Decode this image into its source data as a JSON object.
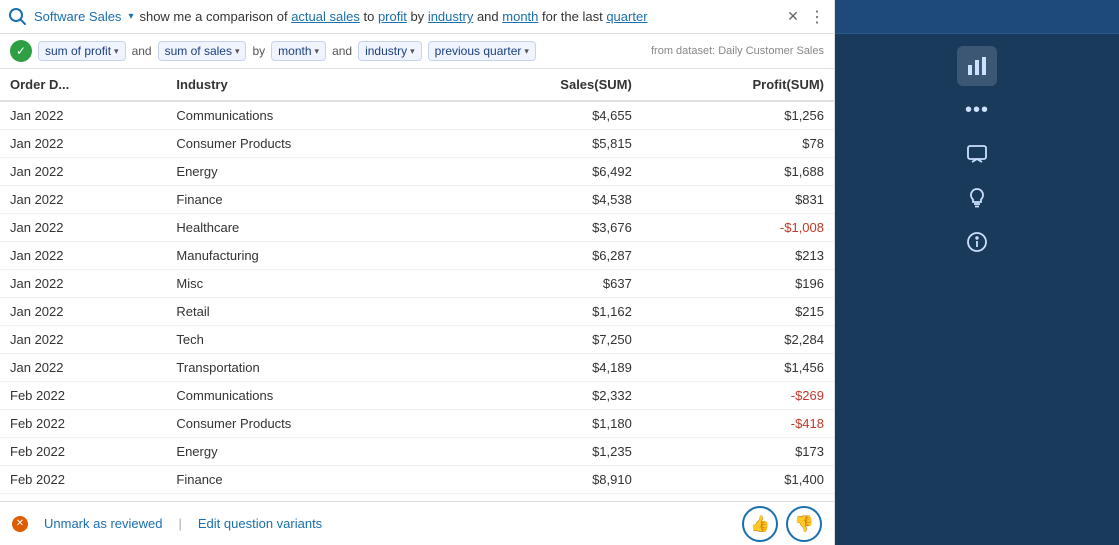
{
  "app": {
    "name": "Software Sales",
    "name_arrow": "▾"
  },
  "search": {
    "query_prefix": "show me a comparison of ",
    "query_part1": "actual sales",
    "query_between1": " to ",
    "query_part2": "profit",
    "query_between2": " by ",
    "query_part3": "industry",
    "query_between3": " and ",
    "query_part4": "month",
    "query_suffix": " for the last ",
    "query_part5": "quarter"
  },
  "filters": {
    "confirm_check": "✓",
    "chip1": "sum of profit",
    "chip1_arrow": "▾",
    "sep1": "and",
    "chip2": "sum of sales",
    "chip2_arrow": "▾",
    "sep2": "by",
    "chip3": "month",
    "chip3_arrow": "▾",
    "sep3": "and",
    "chip4": "industry",
    "chip4_arrow": "▾",
    "chip5": "previous quarter",
    "chip5_arrow": "▾"
  },
  "dataset": {
    "label": "from dataset: Daily Customer Sales"
  },
  "table": {
    "headers": [
      "Order D...",
      "Industry",
      "Sales(SUM)",
      "Profit(SUM)"
    ],
    "rows": [
      [
        "Jan 2022",
        "Communications",
        "$4,655",
        "$1,256"
      ],
      [
        "Jan 2022",
        "Consumer Products",
        "$5,815",
        "$78"
      ],
      [
        "Jan 2022",
        "Energy",
        "$6,492",
        "$1,688"
      ],
      [
        "Jan 2022",
        "Finance",
        "$4,538",
        "$831"
      ],
      [
        "Jan 2022",
        "Healthcare",
        "$3,676",
        "-$1,008"
      ],
      [
        "Jan 2022",
        "Manufacturing",
        "$6,287",
        "$213"
      ],
      [
        "Jan 2022",
        "Misc",
        "$637",
        "$196"
      ],
      [
        "Jan 2022",
        "Retail",
        "$1,162",
        "$215"
      ],
      [
        "Jan 2022",
        "Tech",
        "$7,250",
        "$2,284"
      ],
      [
        "Jan 2022",
        "Transportation",
        "$4,189",
        "$1,456"
      ],
      [
        "Feb 2022",
        "Communications",
        "$2,332",
        "-$269"
      ],
      [
        "Feb 2022",
        "Consumer Products",
        "$1,180",
        "-$418"
      ],
      [
        "Feb 2022",
        "Energy",
        "$1,235",
        "$173"
      ],
      [
        "Feb 2022",
        "Finance",
        "$8,910",
        "$1,400"
      ]
    ]
  },
  "bottom": {
    "unmark_label": "Unmark as reviewed",
    "edit_label": "Edit question variants",
    "thumbup": "👍",
    "thumbdown": "👎"
  },
  "tools": {
    "bar_chart": "📊",
    "more_dots": "•••",
    "comment": "💬",
    "bulb": "💡",
    "info": "ℹ"
  }
}
